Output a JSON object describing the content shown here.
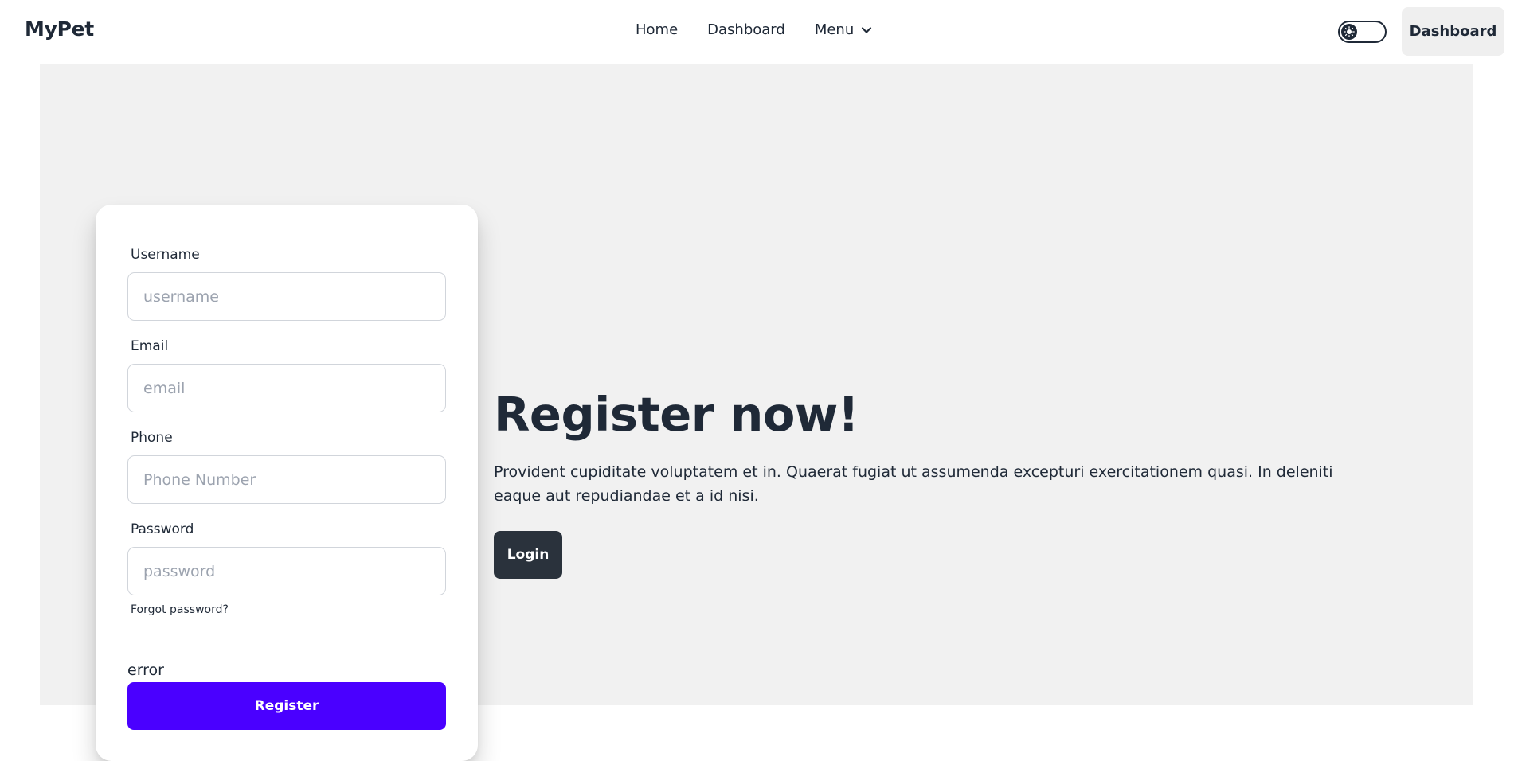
{
  "navbar": {
    "brand": "MyPet",
    "links": [
      "Home",
      "Dashboard"
    ],
    "menu_label": "Menu",
    "menu_icon": "chevron-down-icon",
    "theme_toggle_icon": "sun-icon",
    "dashboard_button": "Dashboard"
  },
  "form": {
    "username": {
      "label": "Username",
      "placeholder": "username",
      "value": ""
    },
    "email": {
      "label": "Email",
      "placeholder": "email",
      "value": ""
    },
    "phone": {
      "label": "Phone",
      "placeholder": "Phone Number",
      "value": ""
    },
    "password": {
      "label": "Password",
      "placeholder": "password",
      "value": ""
    },
    "forgot_password": "Forgot password?",
    "error": "error",
    "submit_label": "Register"
  },
  "hero": {
    "title": "Register now!",
    "text": "Provident cupiditate voluptatem et in. Quaerat fugiat ut assumenda excepturi exercitationem quasi. In deleniti eaque aut repudiandae et a id nisi.",
    "login_label": "Login"
  },
  "colors": {
    "primary": "#4a00ff",
    "neutral": "#2a323c",
    "hero_background": "#f1f1f1",
    "text": "#1f2937"
  }
}
